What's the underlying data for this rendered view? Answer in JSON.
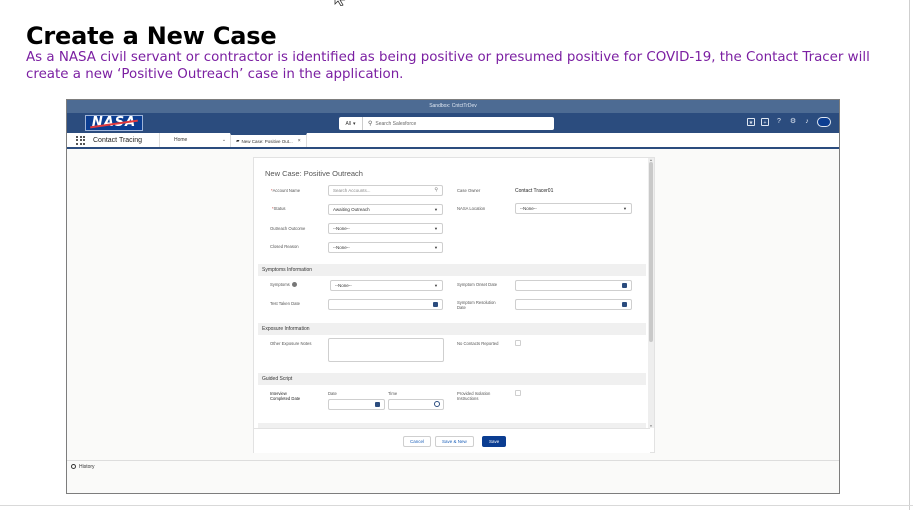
{
  "doc": {
    "title": "Create a New Case",
    "description": "As a NASA civil servant or contractor is identified as being positive or presumed positive for COVID-19, the Contact Tracer will create a new ‘Positive Outreach’ case in the application."
  },
  "app": {
    "sandbox_label": "Sandbox: CntctTrDev",
    "logo_text": "NASA",
    "search": {
      "scope": "All",
      "placeholder": "Search Salesforce"
    },
    "nav": {
      "app_name": "Contact Tracing",
      "home": "Home",
      "tab_label": "New Case: Positive Out..."
    },
    "header_icons": [
      "plus-icon",
      "help-icon",
      "gear-icon",
      "bell-icon",
      "avatar"
    ]
  },
  "modal": {
    "title": "New Case: Positive Outreach",
    "fields": {
      "account_name": {
        "label": "Account Name",
        "required": true,
        "placeholder": "Search Accounts..."
      },
      "case_owner": {
        "label": "Case Owner",
        "value": "Contact Tracer01"
      },
      "status": {
        "label": "Status",
        "required": true,
        "value": "Awaiting Outreach"
      },
      "nasa_location": {
        "label": "NASA Location",
        "value": "--None--"
      },
      "outreach_outcome": {
        "label": "Outreach Outcome",
        "value": "--None--"
      },
      "closed_reason": {
        "label": "Closed Reason",
        "value": "--None--"
      }
    },
    "sections": {
      "symptoms": {
        "header": "Symptoms Information",
        "symptoms_label": "Symptoms",
        "symptoms_value": "--None--",
        "onset_label": "Symptom Onset Date",
        "test_label": "Test Taken Date",
        "resolution_label_1": "Symptom Resolution",
        "resolution_label_2": "Date"
      },
      "exposure": {
        "header": "Exposure Information",
        "notes_label": "Other Exposure Notes",
        "no_contacts_label": "No Contacts Reported"
      },
      "guided": {
        "header": "Guided Script",
        "interview_label_1": "Interview",
        "interview_label_2": "Completed Date",
        "date_label": "Date",
        "time_label": "Time",
        "isolation_label_1": "Provided Isolation",
        "isolation_label_2": "Instructions"
      }
    },
    "buttons": {
      "cancel": "Cancel",
      "save_new": "Save & New",
      "save": "Save"
    }
  },
  "history_label": "History",
  "colors": {
    "header": "#2b4c7e",
    "primary": "#0b3d91",
    "desc_text": "#7b1fa2"
  }
}
